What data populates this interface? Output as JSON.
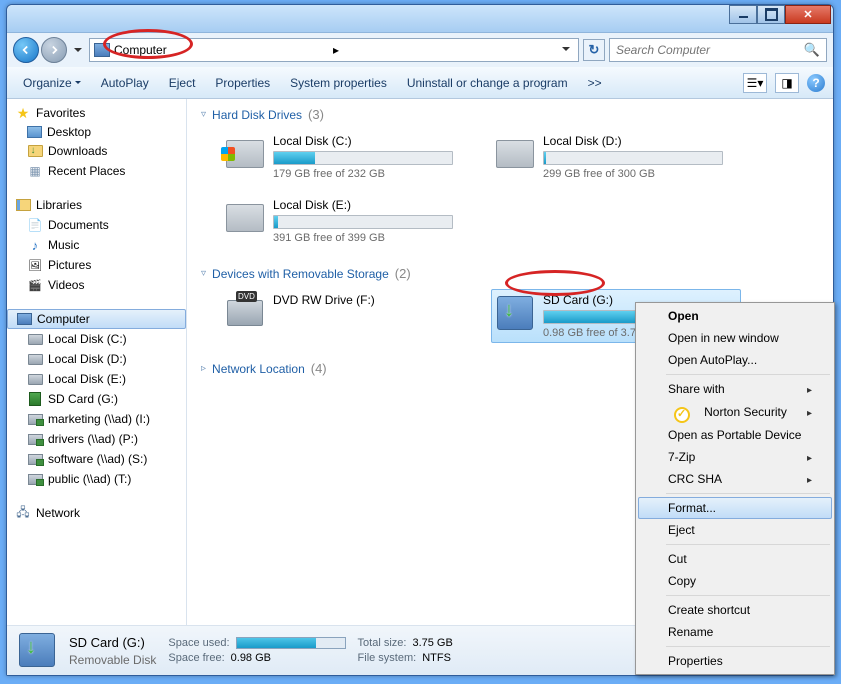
{
  "titlebar": {
    "min": "Minimize",
    "max": "Maximize",
    "close": "Close"
  },
  "address": {
    "location": "Computer",
    "search_placeholder": "Search Computer"
  },
  "toolbar": {
    "organize": "Organize",
    "autoplay": "AutoPlay",
    "eject": "Eject",
    "properties": "Properties",
    "system_properties": "System properties",
    "uninstall": "Uninstall or change a program",
    "chevron": ">>"
  },
  "tree": {
    "favorites": {
      "label": "Favorites",
      "items": [
        {
          "label": "Desktop"
        },
        {
          "label": "Downloads"
        },
        {
          "label": "Recent Places"
        }
      ]
    },
    "libraries": {
      "label": "Libraries",
      "items": [
        {
          "label": "Documents"
        },
        {
          "label": "Music"
        },
        {
          "label": "Pictures"
        },
        {
          "label": "Videos"
        }
      ]
    },
    "computer": {
      "label": "Computer",
      "items": [
        {
          "label": "Local Disk (C:)"
        },
        {
          "label": "Local Disk (D:)"
        },
        {
          "label": "Local Disk (E:)"
        },
        {
          "label": "SD Card (G:)"
        },
        {
          "label": "marketing (\\\\ad) (I:)"
        },
        {
          "label": "drivers (\\\\ad) (P:)"
        },
        {
          "label": "software (\\\\ad) (S:)"
        },
        {
          "label": "public (\\\\ad) (T:)"
        }
      ]
    },
    "network": {
      "label": "Network"
    }
  },
  "groups": {
    "hdd": {
      "title": "Hard Disk Drives",
      "count": "(3)",
      "items": [
        {
          "name": "Local Disk (C:)",
          "free": "179 GB free of 232 GB",
          "pct": 23
        },
        {
          "name": "Local Disk (D:)",
          "free": "299 GB free of 300 GB",
          "pct": 1
        },
        {
          "name": "Local Disk (E:)",
          "free": "391 GB free of 399 GB",
          "pct": 2
        }
      ]
    },
    "removable": {
      "title": "Devices with Removable Storage",
      "count": "(2)",
      "items": [
        {
          "name": "DVD RW Drive (F:)"
        },
        {
          "name": "SD Card (G:)",
          "free": "0.98 GB free of 3.75 GB",
          "pct": 74
        }
      ]
    },
    "netloc": {
      "title": "Network Location",
      "count": "(4)"
    }
  },
  "statusbar": {
    "name": "SD Card (G:)",
    "type": "Removable Disk",
    "space_used_lbl": "Space used:",
    "space_free_lbl": "Space free:",
    "space_free_val": "0.98 GB",
    "total_lbl": "Total size:",
    "total_val": "3.75 GB",
    "fs_lbl": "File system:",
    "fs_val": "NTFS"
  },
  "context_menu": {
    "open": "Open",
    "open_new": "Open in new window",
    "autoplay": "Open AutoPlay...",
    "share": "Share with",
    "norton": "Norton Security",
    "portable": "Open as Portable Device",
    "sevenzip": "7-Zip",
    "crc": "CRC SHA",
    "format": "Format...",
    "eject": "Eject",
    "cut": "Cut",
    "copy": "Copy",
    "shortcut": "Create shortcut",
    "rename": "Rename",
    "properties": "Properties"
  }
}
